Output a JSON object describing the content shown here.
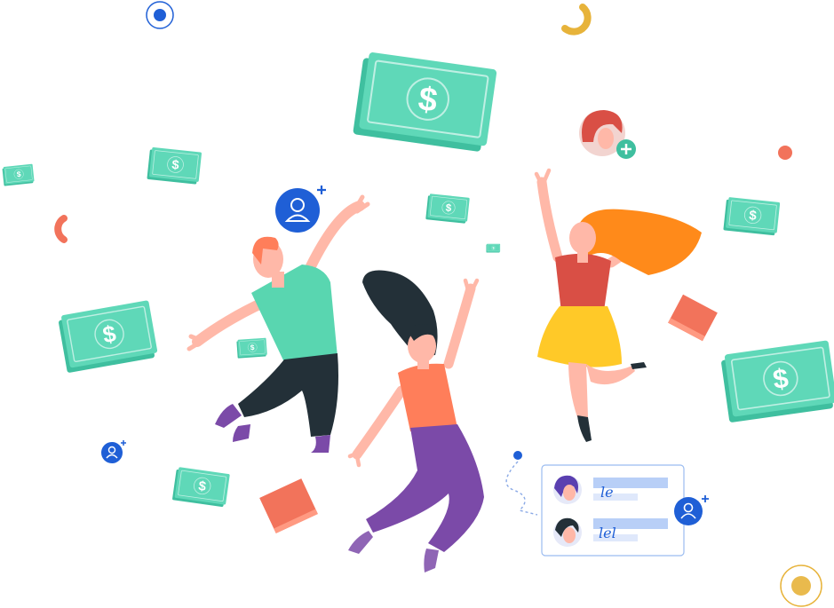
{
  "scene": {
    "alt": "",
    "colors": {
      "bill_dark": "#3fbf9f",
      "bill_light": "#5fd8b8",
      "bill_line": "#ffffff",
      "user_badge": "#1f5fd6",
      "accent_coral": "#f2735b",
      "accent_gold": "#e7b33a",
      "skin": "#ffb8a8",
      "shirt_teal": "#59d6b0",
      "pants_dark": "#233038",
      "shirt_orange": "#ff7e5a",
      "pants_purple": "#7b4aa8",
      "hair_orange": "#ff8a1a",
      "skirt_yellow": "#ffc928",
      "top_red": "#d94f45",
      "panel_border": "#9bbcf0",
      "panel_line": "#b8cff7"
    }
  },
  "bills": [
    {
      "label": "$"
    },
    {
      "label": "$"
    },
    {
      "label": "$"
    },
    {
      "label": "$"
    },
    {
      "label": "$"
    },
    {
      "label": "$"
    },
    {
      "label": "$"
    },
    {
      "label": "$"
    },
    {
      "label": "$"
    },
    {
      "label": "$"
    }
  ],
  "user_cards": {
    "signature_1": "le",
    "signature_2": "lel"
  }
}
